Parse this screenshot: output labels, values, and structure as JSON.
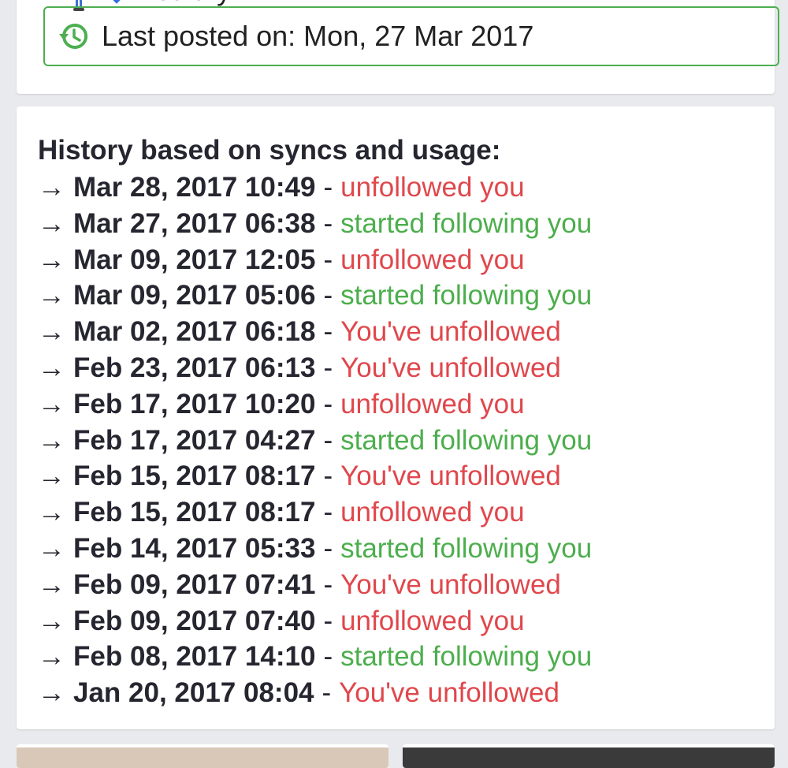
{
  "status": {
    "label": "Healthy",
    "figure_icon": "person-figure-icon",
    "diamond_icon": "blue-diamond-icon",
    "moon_icon": "moon-icon"
  },
  "last_posted": {
    "icon": "history-icon",
    "text": "Last posted on: Mon, 27 Mar 2017",
    "border_color": "#4caf50"
  },
  "history": {
    "title": "History based on syncs and usage:",
    "arrow": "→",
    "separator": "-",
    "colors": {
      "red": "#e0474c",
      "green": "#4cae4c"
    },
    "items": [
      {
        "date": "Mar 28, 2017 10:49",
        "action": "unfollowed you",
        "color": "red"
      },
      {
        "date": "Mar 27, 2017 06:38",
        "action": "started following you",
        "color": "green"
      },
      {
        "date": "Mar 09, 2017 12:05",
        "action": "unfollowed you",
        "color": "red"
      },
      {
        "date": "Mar 09, 2017 05:06",
        "action": "started following you",
        "color": "green"
      },
      {
        "date": "Mar 02, 2017 06:18",
        "action": "You've unfollowed",
        "color": "red"
      },
      {
        "date": "Feb 23, 2017 06:13",
        "action": "You've unfollowed",
        "color": "red"
      },
      {
        "date": "Feb 17, 2017 10:20",
        "action": "unfollowed you",
        "color": "red"
      },
      {
        "date": "Feb 17, 2017 04:27",
        "action": "started following you",
        "color": "green"
      },
      {
        "date": "Feb 15, 2017 08:17",
        "action": "You've unfollowed",
        "color": "red"
      },
      {
        "date": "Feb 15, 2017 08:17",
        "action": "unfollowed you",
        "color": "red"
      },
      {
        "date": "Feb 14, 2017 05:33",
        "action": "started following you",
        "color": "green"
      },
      {
        "date": "Feb 09, 2017 07:41",
        "action": "You've unfollowed",
        "color": "red"
      },
      {
        "date": "Feb 09, 2017 07:40",
        "action": "unfollowed you",
        "color": "red"
      },
      {
        "date": "Feb 08, 2017 14:10",
        "action": "started following you",
        "color": "green"
      },
      {
        "date": "Jan 20, 2017 08:04",
        "action": "You've unfollowed",
        "color": "red"
      }
    ]
  }
}
